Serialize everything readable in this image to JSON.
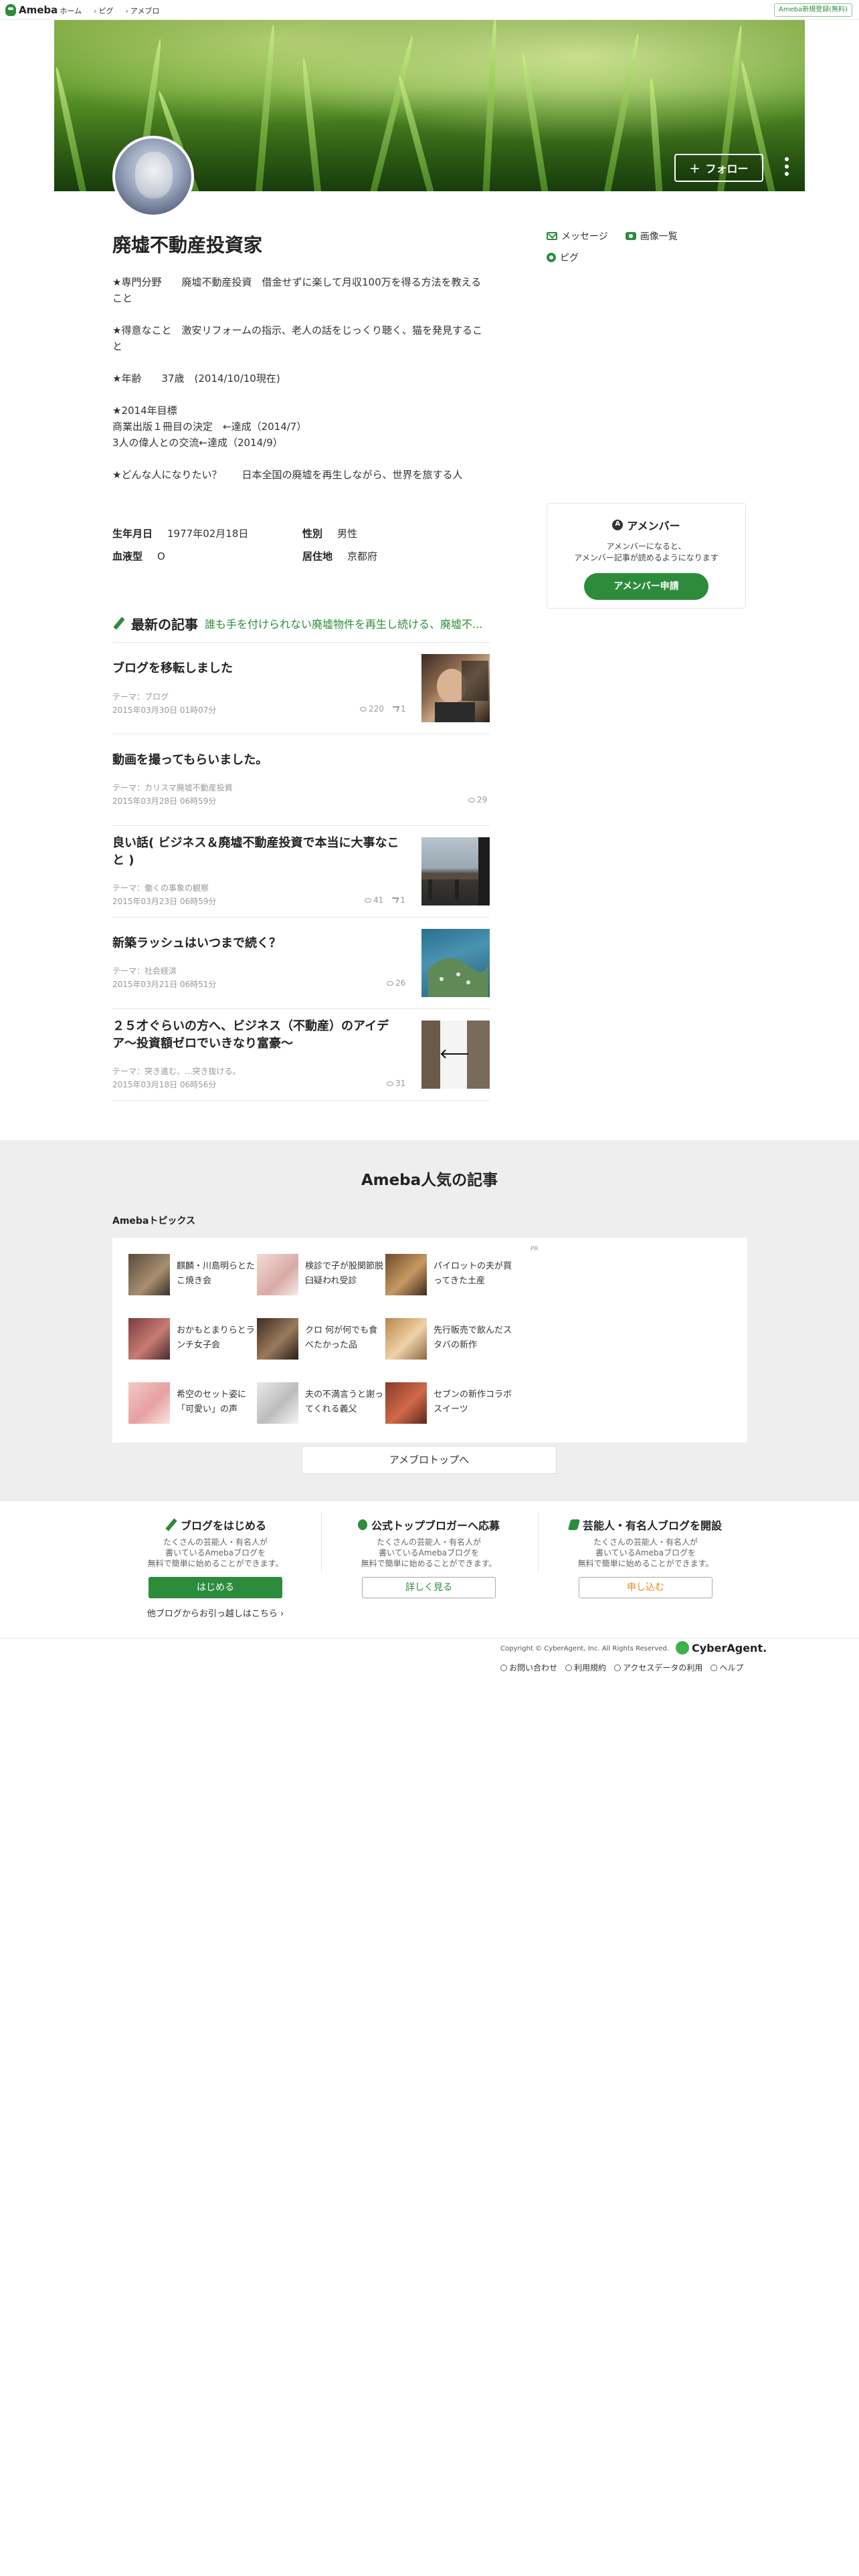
{
  "header": {
    "logo_text": "Ameba",
    "nav": [
      "ホーム",
      "ピグ",
      "アメブロ"
    ],
    "signup": "Ameba新規登録(無料)"
  },
  "cover": {
    "follow_label": "フォロー"
  },
  "profile": {
    "blog_title": "廃墟不動産投資家",
    "paragraphs": [
      "★専門分野　　廃墟不動産投資　借金せずに楽して月収100万を得る方法を教えること",
      "",
      "★得意なこと　激安リフォームの指示、老人の話をじっくり聴く、猫を発見すること",
      "",
      "★年齢　　37歳　(2014/10/10現在)",
      "",
      "★2014年目標",
      "商業出版１冊目の決定　←達成（2014/7）",
      "3人の偉人との交流←達成（2014/9）",
      "",
      "★どんな人になりたい？　　日本全国の廃墟を再生しながら、世界を旅する人"
    ],
    "facts": {
      "birthday_label": "生年月日",
      "birthday": "1977年02月18日",
      "gender_label": "性別",
      "gender": "男性",
      "blood_label": "血液型",
      "blood": "O",
      "residence_label": "居住地",
      "residence": "京都府"
    }
  },
  "side": {
    "message": "メッセージ",
    "images": "画像一覧",
    "pigg": "ピグ",
    "amember_title": "アメンバー",
    "amember_desc_1": "アメンバーになると、",
    "amember_desc_2": "アメンバー記事が読めるようになります",
    "amember_button": "アメンバー申請"
  },
  "latest": {
    "label": "最新の記事",
    "subtitle": "誰も手を付けられない廃墟物件を再生し続ける、廃墟不..."
  },
  "articles": [
    {
      "title": "ブログを移転しました",
      "theme": "テーマ：ブログ",
      "date": "2015年03月30日 01時07分",
      "views": "220",
      "reblogs": "1"
    },
    {
      "title": "動画を撮ってもらいました。",
      "theme": "テーマ：カリスマ廃墟不動産投資",
      "date": "2015年03月28日 06時59分",
      "views": "29",
      "reblogs": ""
    },
    {
      "title": "良い話( ビジネス＆廃墟不動産投資で本当に大事なこと )",
      "theme": "テーマ：働くの事象の観察",
      "date": "2015年03月23日 06時59分",
      "views": "41",
      "reblogs": "1"
    },
    {
      "title": "新築ラッシュはいつまで続く？",
      "theme": "テーマ：社会経済",
      "date": "2015年03月21日 06時51分",
      "views": "26",
      "reblogs": ""
    },
    {
      "title": "２５才ぐらいの方へ、ビジネス（不動産）のアイデア〜投資額ゼロでいきなり富豪〜",
      "theme": "テーマ：突き進む、...突き抜ける。",
      "date": "2015年03月18日 06時56分",
      "views": "31",
      "reblogs": ""
    }
  ],
  "popular": {
    "title": "Ameba人気の記事",
    "topics_label": "Amebaトピックス",
    "pr": "PR",
    "topics": [
      "麒麟・川島明らとたこ焼き会",
      "検診で子が股関節脱臼疑われ受診",
      "パイロットの夫が買ってきた土産",
      "おかもとまりらとランチ女子会",
      "クロ 何が何でも食べたかった品",
      "先行販売で飲んだスタバの新作",
      "希空のセット姿に「可愛い」の声",
      "夫の不満言うと謝ってくれる義父",
      "セブンの新作コラボスイーツ"
    ],
    "top_button": "アメブロトップへ"
  },
  "cta": [
    {
      "title": "ブログをはじめる",
      "desc_1": "たくさんの芸能人・有名人が",
      "desc_2": "書いているAmebaブログを",
      "desc_3": "無料で簡単に始めることができます。",
      "button": "はじめる",
      "link": "他ブログからお引っ越しはこちら ›"
    },
    {
      "title": "公式トップブロガーへ応募",
      "desc_1": "たくさんの芸能人・有名人が",
      "desc_2": "書いているAmebaブログを",
      "desc_3": "無料で簡単に始めることができます。",
      "button": "詳しく見る",
      "link": ""
    },
    {
      "title": "芸能人・有名人ブログを開設",
      "desc_1": "たくさんの芸能人・有名人が",
      "desc_2": "書いているAmebaブログを",
      "desc_3": "無料で簡単に始めることができます。",
      "button": "申し込む",
      "link": ""
    }
  ],
  "footer": {
    "copyright": "Copyright © CyberAgent, Inc. All Rights Reserved.",
    "brand": "CyberAgent.",
    "links": [
      "お問い合わせ",
      "利用規約",
      "アクセスデータの利用",
      "ヘルプ"
    ]
  }
}
